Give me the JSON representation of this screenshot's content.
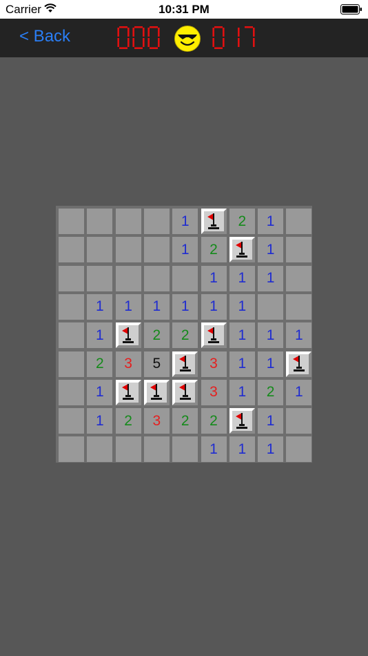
{
  "status_bar": {
    "carrier": "Carrier",
    "time": "10:31 PM"
  },
  "nav": {
    "back_label": "< Back",
    "mine_counter": "000",
    "timer": "017",
    "face": "cool-smiley-with-sunglasses",
    "digit_color": "#e01010"
  },
  "board": {
    "rows": 9,
    "cols": 9,
    "cells": [
      [
        "",
        "",
        "",
        "",
        "1",
        "F",
        "2",
        "1",
        ""
      ],
      [
        "",
        "",
        "",
        "",
        "1",
        "2",
        "F",
        "1",
        ""
      ],
      [
        "",
        "",
        "",
        "",
        "",
        "1",
        "1",
        "1",
        ""
      ],
      [
        "",
        "1",
        "1",
        "1",
        "1",
        "1",
        "1",
        "",
        ""
      ],
      [
        "",
        "1",
        "F",
        "2",
        "2",
        "F",
        "1",
        "1",
        "1"
      ],
      [
        "",
        "2",
        "3",
        "5",
        "F",
        "3",
        "1",
        "1",
        "F"
      ],
      [
        "",
        "1",
        "F",
        "F",
        "F",
        "3",
        "1",
        "2",
        "1"
      ],
      [
        "",
        "1",
        "2",
        "3",
        "2",
        "2",
        "F",
        "1",
        ""
      ],
      [
        "",
        "",
        "",
        "",
        "",
        "1",
        "1",
        "1",
        ""
      ]
    ]
  },
  "colors": {
    "number_1": "#1f2cd0",
    "number_2": "#158a1b",
    "number_3": "#e51f1f",
    "number_5": "#111111",
    "flag": "#e00000",
    "back_link": "#2a7ef5",
    "face": "#ffee00"
  }
}
